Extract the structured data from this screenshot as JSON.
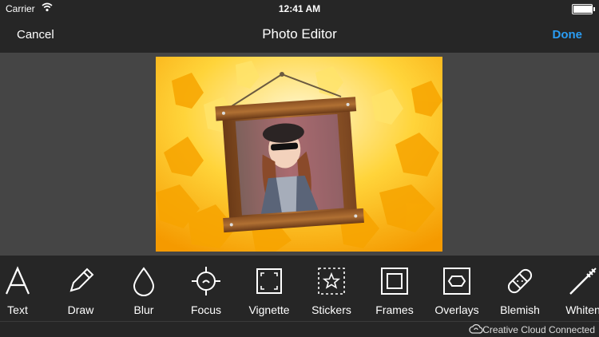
{
  "status": {
    "carrier": "Carrier",
    "time": "12:41 AM",
    "battery_level": 0.95
  },
  "nav": {
    "cancel": "Cancel",
    "title": "Photo Editor",
    "done": "Done"
  },
  "colors": {
    "accent": "#2a9df4",
    "bar": "#262626",
    "canvas": "#454545"
  },
  "tools": [
    {
      "label": "Text",
      "icon": "text-icon"
    },
    {
      "label": "Draw",
      "icon": "pencil-icon"
    },
    {
      "label": "Blur",
      "icon": "droplet-icon"
    },
    {
      "label": "Focus",
      "icon": "focus-crosshair-icon"
    },
    {
      "label": "Vignette",
      "icon": "vignette-icon"
    },
    {
      "label": "Stickers",
      "icon": "star-sticker-icon"
    },
    {
      "label": "Frames",
      "icon": "frame-icon"
    },
    {
      "label": "Overlays",
      "icon": "hexagon-overlay-icon"
    },
    {
      "label": "Blemish",
      "icon": "bandage-icon"
    },
    {
      "label": "Whiten",
      "icon": "toothbrush-icon"
    }
  ],
  "footer": {
    "text": "Creative Cloud Connected"
  }
}
